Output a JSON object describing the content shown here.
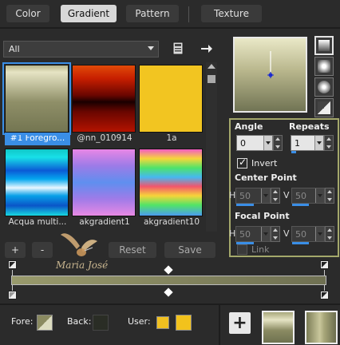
{
  "tabs": [
    {
      "label": "Color",
      "active": false
    },
    {
      "label": "Gradient",
      "active": true
    },
    {
      "label": "Pattern",
      "active": false
    },
    {
      "label": "Texture",
      "active": false
    }
  ],
  "filter": {
    "value": "All"
  },
  "library": {
    "swatches": [
      {
        "label": "#1 Foregro...",
        "selected": true
      },
      {
        "label": "@nn_010914",
        "selected": false
      },
      {
        "label": "1a",
        "selected": false
      },
      {
        "label": "Acqua multi...",
        "selected": false
      },
      {
        "label": "akgradient1",
        "selected": false
      },
      {
        "label": "akgradient10",
        "selected": false
      }
    ]
  },
  "buttons": {
    "add": "+",
    "remove": "-",
    "reset": "Reset",
    "save": "Save",
    "new_gradient": "+"
  },
  "watermark": {
    "text": "Maria José"
  },
  "settings": {
    "angle_label": "Angle",
    "angle_value": "0",
    "repeats_label": "Repeats",
    "repeats_value": "1",
    "invert_label": "Invert",
    "invert_checked": true,
    "center_point_label": "Center Point",
    "center_h": "50",
    "center_v": "50",
    "focal_point_label": "Focal Point",
    "focal_h": "50",
    "focal_v": "50",
    "h_label": "H",
    "v_label": "V",
    "link_label": "Link",
    "link_checked": false
  },
  "bottom": {
    "fore_label": "Fore:",
    "back_label": "Back:",
    "user_label": "User:"
  },
  "colors": {
    "accent": "#3a8ee6",
    "panel_border": "#a4a86b",
    "user_color_1": "#f0c020",
    "user_color_2": "#f2c21c",
    "back_color": "#2a2d25"
  }
}
